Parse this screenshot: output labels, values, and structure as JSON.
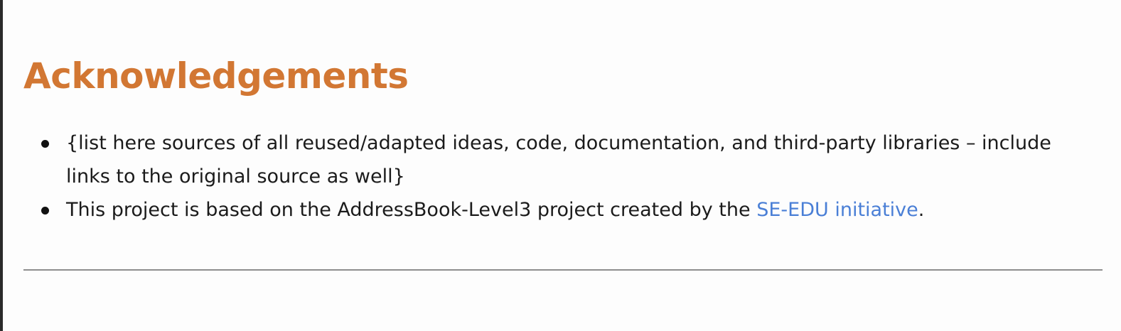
{
  "section": {
    "heading": "Acknowledgements",
    "items": [
      {
        "text": "{list here sources of all reused/adapted ideas, code, documentation, and third-party libraries – include links to the original source as well}"
      },
      {
        "text_before": "This project is based on the AddressBook-Level3 project created by the ",
        "link_text": "SE-EDU initiative",
        "text_after": "."
      }
    ]
  },
  "colors": {
    "heading": "#d27733",
    "link": "#4a7fd6",
    "text": "#1b1b1b",
    "background": "#fdfdfd",
    "rule": "#8e8e8e"
  }
}
